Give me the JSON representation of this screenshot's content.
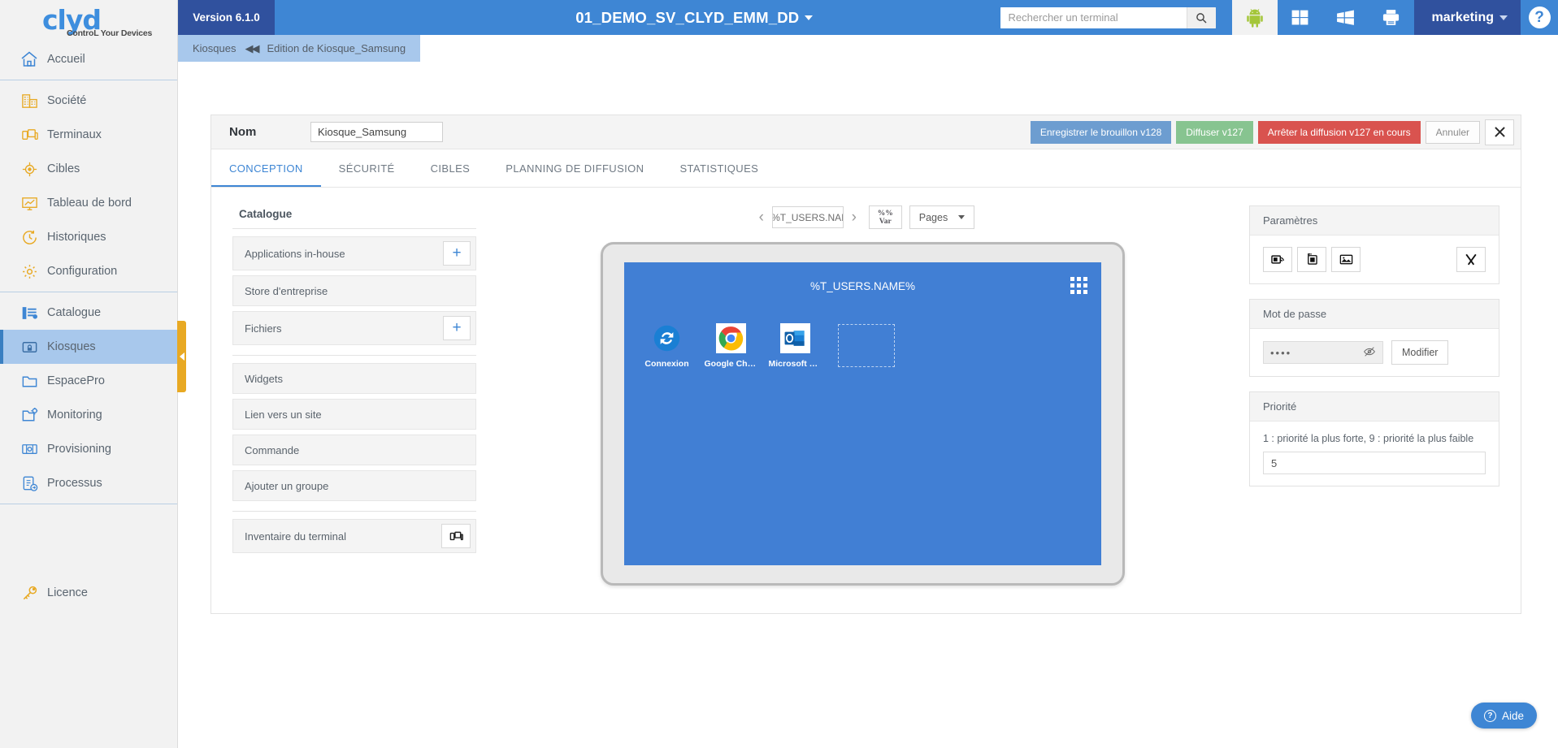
{
  "brand": {
    "logo_text": "clyd",
    "logo_tagline": "ControL Your Devices",
    "accent_blue": "#3e86d4",
    "accent_darkblue": "#30519e",
    "accent_gold": "#e8a923"
  },
  "topbar": {
    "version": "Version 6.1.0",
    "title": "01_DEMO_SV_CLYD_EMM_DD",
    "search_placeholder": "Rechercher un terminal",
    "search_value": "",
    "search_icon": "search-icon",
    "os_filters": [
      {
        "name": "android-icon",
        "label": "Android"
      },
      {
        "name": "windows-tile-icon",
        "label": "Windows 10"
      },
      {
        "name": "windows-legacy-icon",
        "label": "Windows"
      },
      {
        "name": "printer-icon",
        "label": "Imprimantes"
      }
    ],
    "user": "marketing",
    "help_label": "?"
  },
  "breadcrumb": {
    "root": "Kiosques",
    "separator": "◀◀",
    "current": "Edition de Kiosque_Samsung"
  },
  "sidebar": {
    "group1": [
      {
        "label": "Accueil",
        "icon": "home-icon"
      }
    ],
    "group2": [
      {
        "label": "Société",
        "icon": "company-icon"
      },
      {
        "label": "Terminaux",
        "icon": "devices-icon"
      },
      {
        "label": "Cibles",
        "icon": "target-icon"
      },
      {
        "label": "Tableau de bord",
        "icon": "dashboard-icon"
      },
      {
        "label": "Historiques",
        "icon": "history-clock-icon"
      },
      {
        "label": "Configuration",
        "icon": "gear-icon"
      }
    ],
    "group3": [
      {
        "label": "Catalogue",
        "icon": "catalog-list-icon",
        "active": false
      },
      {
        "label": "Kiosques",
        "icon": "kiosk-lock-icon",
        "active": true
      },
      {
        "label": "EspacePro",
        "icon": "folder-icon",
        "active": false
      },
      {
        "label": "Monitoring",
        "icon": "monitoring-icon",
        "active": false
      },
      {
        "label": "Provisioning",
        "icon": "provisioning-icon",
        "active": false
      },
      {
        "label": "Processus",
        "icon": "process-icon",
        "active": false
      }
    ],
    "footer": {
      "label": "Licence",
      "icon": "key-icon"
    },
    "collapse_handle": "collapse-sidebar-handle"
  },
  "editor": {
    "nom_label": "Nom",
    "nom_value": "Kiosque_Samsung",
    "actions": {
      "save_draft": "Enregistrer le brouillon v128",
      "publish": "Diffuser v127",
      "stop": "Arrêter la diffusion v127 en cours",
      "cancel": "Annuler",
      "close_icon": "close-icon"
    },
    "tabs": [
      {
        "label": "CONCEPTION",
        "active": true
      },
      {
        "label": "SÉCURITÉ",
        "active": false
      },
      {
        "label": "CIBLES",
        "active": false
      },
      {
        "label": "PLANNING DE DIFFUSION",
        "active": false
      },
      {
        "label": "STATISTIQUES",
        "active": false
      }
    ]
  },
  "catalogue": {
    "title": "Catalogue",
    "group1": [
      {
        "label": "Applications in-house",
        "add": true
      },
      {
        "label": "Store d'entreprise",
        "add": false
      },
      {
        "label": "Fichiers",
        "add": true
      }
    ],
    "group2": [
      {
        "label": "Widgets"
      },
      {
        "label": "Lien vers un site"
      },
      {
        "label": "Commande"
      },
      {
        "label": "Ajouter un groupe"
      }
    ],
    "group3": [
      {
        "label": "Inventaire du terminal",
        "icon": "devices-icon"
      }
    ],
    "plus_icon": "plus-icon"
  },
  "preview": {
    "prev_icon": "chevron-left-icon",
    "page_name": "%T_USERS.NAI",
    "next_icon": "chevron-right-icon",
    "var_button": {
      "line1": "%%",
      "line2": "Var"
    },
    "pages_button": "Pages",
    "screen": {
      "title": "%T_USERS.NAME%",
      "grid_icon": "app-grid-icon",
      "background": "#417fd4",
      "apps": [
        {
          "label": "Connexion",
          "icon": "sync-connexion-icon"
        },
        {
          "label": "Google Chro...",
          "icon": "chrome-icon"
        },
        {
          "label": "Microsoft Ou...",
          "icon": "outlook-icon"
        },
        {
          "label": "",
          "icon": "empty-slot-placeholder"
        }
      ]
    }
  },
  "settings_panel": {
    "title": "Paramètres",
    "buttons": [
      {
        "name": "screen-layout-icon"
      },
      {
        "name": "add-page-icon"
      },
      {
        "name": "wallpaper-image-icon"
      },
      {
        "name": "tools-icon"
      }
    ]
  },
  "password_panel": {
    "title": "Mot de passe",
    "value": "••••",
    "eye_icon": "eye-hidden-icon",
    "modify_label": "Modifier"
  },
  "priority_panel": {
    "title": "Priorité",
    "hint": "1 : priorité la plus forte, 9 : priorité la plus faible",
    "value": "5"
  },
  "aide": {
    "label": "Aide",
    "icon": "question-icon"
  }
}
